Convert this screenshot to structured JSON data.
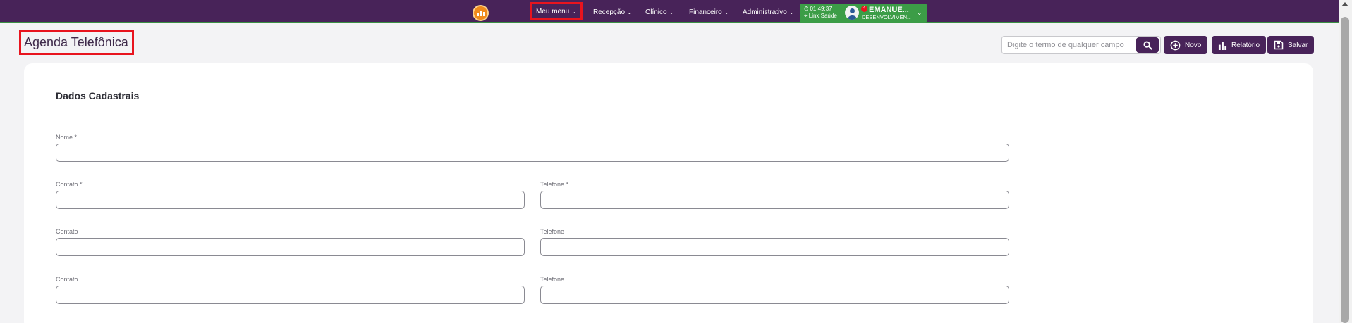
{
  "nav": {
    "items": [
      {
        "label": "Meu menu"
      },
      {
        "label": "Recepção"
      },
      {
        "label": "Clínico"
      },
      {
        "label": "Financeiro"
      },
      {
        "label": "Administrativo"
      }
    ],
    "status": {
      "time": "01:49:37",
      "location": "Linx Saúde",
      "notification_count": "4",
      "user_name": "EMANUE...",
      "user_role": "DESENVOLVIMEN..."
    }
  },
  "page": {
    "title": "Agenda Telefônica"
  },
  "toolbar": {
    "search_placeholder": "Digite o termo de qualquer campo",
    "new_label": "Novo",
    "report_label": "Relatório",
    "save_label": "Salvar"
  },
  "form": {
    "section_title": "Dados Cadastrais",
    "fields": {
      "nome": {
        "label": "Nome *",
        "value": ""
      },
      "contato1": {
        "label": "Contato *",
        "value": ""
      },
      "telefone1": {
        "label": "Telefone *",
        "value": ""
      },
      "contato2": {
        "label": "Contato",
        "value": ""
      },
      "telefone2": {
        "label": "Telefone",
        "value": ""
      },
      "contato3": {
        "label": "Contato",
        "value": ""
      },
      "telefone3": {
        "label": "Telefone",
        "value": ""
      }
    }
  },
  "colors": {
    "brand": "#482359",
    "status_green": "#3c9d47",
    "highlight_red": "#e8141e",
    "logo_orange": "#f08a1c"
  },
  "icons": {
    "logo": "chart-logo-icon",
    "search": "search-icon",
    "new": "plus-circle-icon",
    "report": "bar-chart-icon",
    "save": "floppy-disk-icon",
    "clock": "clock-icon",
    "location": "location-pin-icon",
    "user": "user-avatar-icon"
  }
}
